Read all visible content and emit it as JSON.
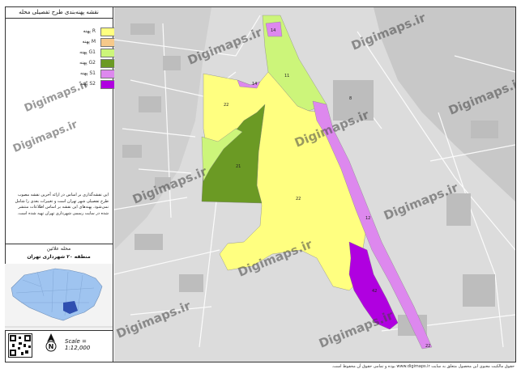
{
  "title": "نقشه پهنه‌بندی طرح تفصیلی محله",
  "legend": [
    {
      "code": "R",
      "label": "پهنه R",
      "color": "#ffff80"
    },
    {
      "code": "M",
      "label": "پهنه M",
      "color": "#f6c98a"
    },
    {
      "code": "G1",
      "label": "پهنه G1",
      "color": "#ccf57a"
    },
    {
      "code": "G2",
      "label": "پهنه G2",
      "color": "#6b9a24"
    },
    {
      "code": "S1",
      "label": "پهنه S1",
      "color": "#dd88ee"
    },
    {
      "code": "S2",
      "label": "پهنه S2",
      "color": "#b000e0"
    }
  ],
  "description": "این نقشه‌گذاری بر اساس در ارائه آخرین نقشه مصوب طرح تفصیلی شهر تهران است و تغییرات بعدی را شامل نمی‌شود. پهنه‌های این نقشه بر اساس اطلاعات منتشر شده در سایت رسمی شهرداری تهران تهیه شده است.",
  "district": {
    "name": "محله علائین",
    "region": "منطقه ۲۰ شهرداری تهران"
  },
  "scale": "Scale = 1:12,000",
  "watermark": "Digimaps.ir",
  "footer": "حقوق مالکیت معنوی این محصول متعلق به سایت www.digimaps.ir بوده و تمامی حقوق آن محفوظ است.",
  "zone_labels": [
    "14",
    "11",
    "14",
    "22",
    "21",
    "22",
    "12",
    "42",
    "22",
    "8"
  ]
}
